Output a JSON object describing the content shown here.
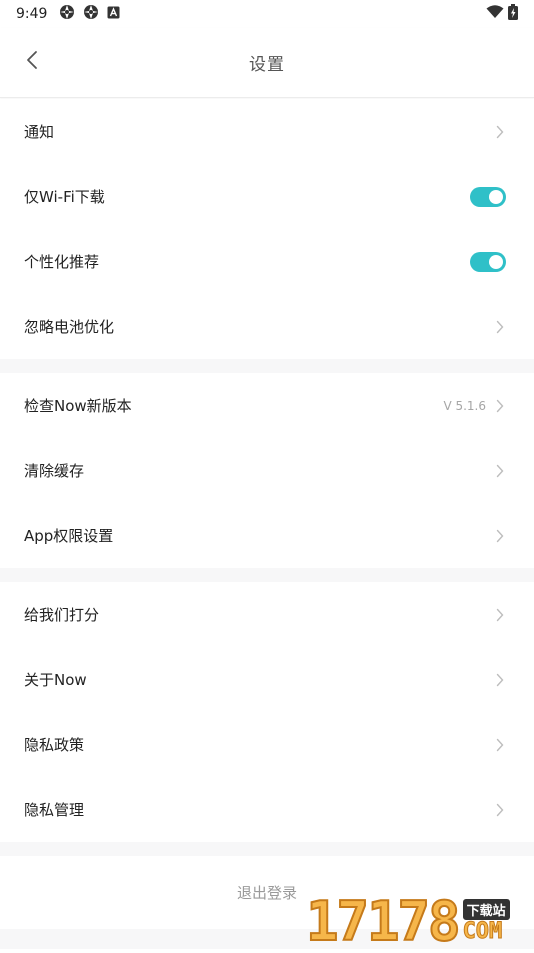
{
  "status_bar": {
    "time": "9:49",
    "left_icons": [
      "aperture-icon",
      "aperture-icon",
      "a-box-icon"
    ],
    "right_icons": [
      "wifi-icon",
      "battery-icon"
    ]
  },
  "header": {
    "title": "设置",
    "back_icon": "chevron-left-icon"
  },
  "groups": [
    {
      "items": [
        {
          "label": "通知",
          "control": "chevron"
        },
        {
          "label": "仅Wi-Fi下载",
          "control": "toggle",
          "on": true
        },
        {
          "label": "个性化推荐",
          "control": "toggle",
          "on": true
        },
        {
          "label": "忽略电池优化",
          "control": "chevron"
        }
      ]
    },
    {
      "items": [
        {
          "label": "检查Now新版本",
          "control": "chevron",
          "value": "V 5.1.6"
        },
        {
          "label": "清除缓存",
          "control": "chevron"
        },
        {
          "label": "App权限设置",
          "control": "chevron"
        }
      ]
    },
    {
      "items": [
        {
          "label": "给我们打分",
          "control": "chevron"
        },
        {
          "label": "关于Now",
          "control": "chevron"
        },
        {
          "label": "隐私政策",
          "control": "chevron"
        },
        {
          "label": "隐私管理",
          "control": "chevron"
        }
      ]
    }
  ],
  "logout_label": "退出登录",
  "watermark": {
    "digits": "17178",
    "badge": "下载站",
    "suffix": "COM"
  },
  "colors": {
    "accent": "#2fc0c8",
    "divider": "#f7f7f8",
    "chevron": "#bdbdbd"
  }
}
